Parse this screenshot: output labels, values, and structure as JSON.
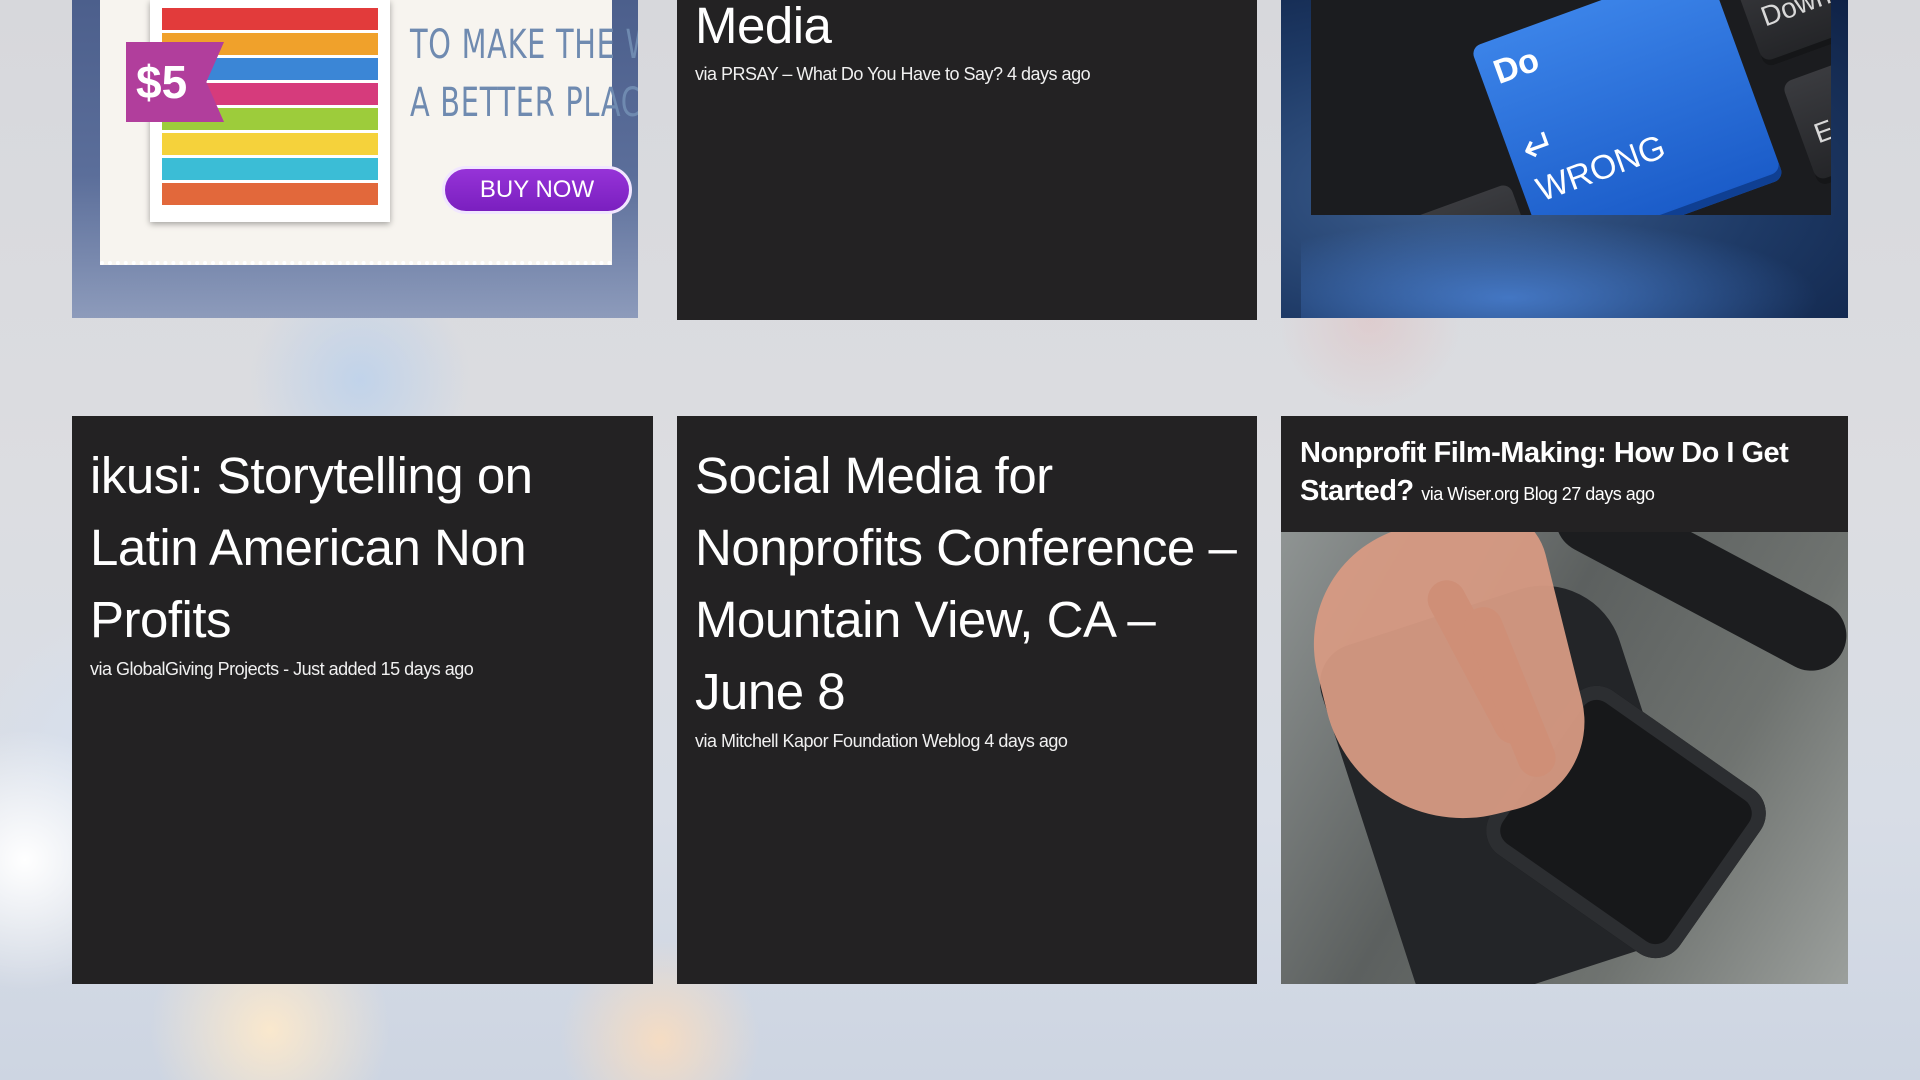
{
  "tiles": {
    "ad": {
      "price": "$5",
      "slogan_lines": [
        "TO MAKE THE WORLD",
        "A BETTER PLACE"
      ],
      "buy_label": "BUY NOW"
    },
    "media": {
      "title": "Media",
      "meta": "via PRSAY – What Do You Have to Say? 4 days ago"
    },
    "keyboard": {
      "key_main": "WRONG",
      "key_top": "Do",
      "key_page": "Page Down",
      "key_end": "En"
    },
    "ikusi": {
      "title": "ikusi: Storytelling on Latin American Non Profits",
      "meta": "via GlobalGiving Projects - Just added 15 days ago"
    },
    "conference": {
      "title": "Social Media for Nonprofits Conference – Mountain View, CA – June 8",
      "meta": "via Mitchell Kapor Foundation Weblog 4 days ago"
    },
    "film": {
      "title": "Nonprofit Film-Making: How Do I Get Started?",
      "meta": "via Wiser.org Blog 27 days ago"
    }
  },
  "colors": {
    "tile_dark": "#232223",
    "buy_button": "#8a2bd2",
    "price_tag": "#b13e9c",
    "key_blue": "#2a6fdc"
  }
}
